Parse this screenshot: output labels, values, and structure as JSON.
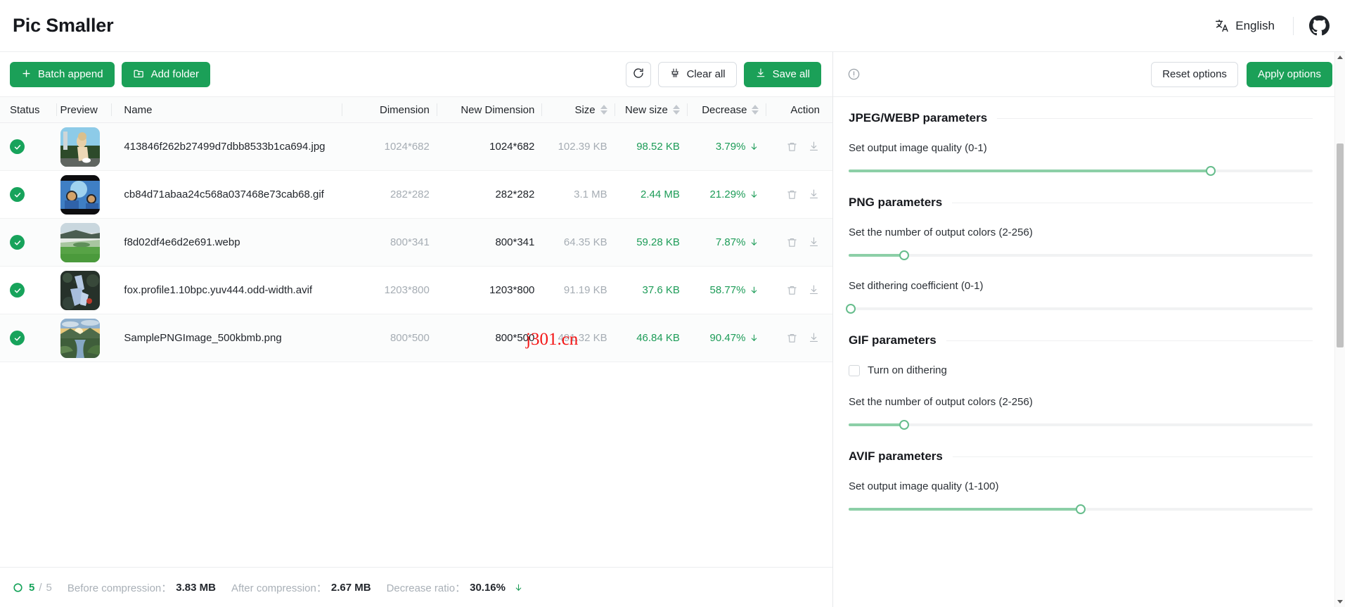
{
  "header": {
    "brand": "Pic Smaller",
    "language_label": "English",
    "language_icon": "translate-icon",
    "github_icon": "github-icon"
  },
  "toolbar": {
    "batch_append_label": "Batch append",
    "add_folder_label": "Add folder",
    "refresh_icon": "refresh-icon",
    "clear_all_label": "Clear all",
    "save_all_label": "Save all"
  },
  "options_toolbar": {
    "info_icon": "info-circle-icon",
    "reset_label": "Reset options",
    "apply_label": "Apply options"
  },
  "table": {
    "columns": [
      {
        "key": "status",
        "label": "Status",
        "sortable": false
      },
      {
        "key": "preview",
        "label": "Preview",
        "sortable": false
      },
      {
        "key": "name",
        "label": "Name",
        "sortable": false
      },
      {
        "key": "dimension",
        "label": "Dimension",
        "sortable": false
      },
      {
        "key": "newdim",
        "label": "New Dimension",
        "sortable": false
      },
      {
        "key": "size",
        "label": "Size",
        "sortable": true
      },
      {
        "key": "newsize",
        "label": "New size",
        "sortable": true
      },
      {
        "key": "decrease",
        "label": "Decrease",
        "sortable": true
      },
      {
        "key": "action",
        "label": "Action",
        "sortable": false
      }
    ],
    "rows": [
      {
        "status": "done",
        "name": "413846f262b27499d7dbb8533b1ca694.jpg",
        "dimension": "1024*682",
        "new_dimension": "1024*682",
        "size": "102.39 KB",
        "new_size": "98.52 KB",
        "decrease": "3.79%"
      },
      {
        "status": "done",
        "name": "cb84d71abaa24c568a037468e73cab68.gif",
        "dimension": "282*282",
        "new_dimension": "282*282",
        "size": "3.1 MB",
        "new_size": "2.44 MB",
        "decrease": "21.29%"
      },
      {
        "status": "done",
        "name": "f8d02df4e6d2e691.webp",
        "dimension": "800*341",
        "new_dimension": "800*341",
        "size": "64.35 KB",
        "new_size": "59.28 KB",
        "decrease": "7.87%"
      },
      {
        "status": "done",
        "name": "fox.profile1.10bpc.yuv444.odd-width.avif",
        "dimension": "1203*800",
        "new_dimension": "1203*800",
        "size": "91.19 KB",
        "new_size": "37.6 KB",
        "decrease": "58.77%"
      },
      {
        "status": "done",
        "name": "SamplePNGImage_500kbmb.png",
        "dimension": "800*500",
        "new_dimension": "800*500",
        "size": "491.32 KB",
        "new_size": "46.84 KB",
        "decrease": "90.47%"
      }
    ],
    "row_actions": {
      "delete_icon": "trash-icon",
      "download_icon": "download-icon"
    }
  },
  "footer": {
    "progress_icon": "circle-icon",
    "done_count": "5",
    "total_sep": "/",
    "total_count": "5",
    "before_label": "Before compression：",
    "before_value": "3.83 MB",
    "after_label": "After compression：",
    "after_value": "2.67 MB",
    "ratio_label": "Decrease ratio：",
    "ratio_value": "30.16%"
  },
  "options": {
    "sections": [
      {
        "title": "JPEG/WEBP parameters",
        "fields": [
          {
            "type": "slider",
            "label": "Set output image quality (0-1)",
            "percent": 78
          }
        ]
      },
      {
        "title": "PNG parameters",
        "fields": [
          {
            "type": "slider",
            "label": "Set the number of output colors (2-256)",
            "percent": 12
          },
          {
            "type": "slider",
            "label": "Set dithering coefficient (0-1)",
            "percent": 0
          }
        ]
      },
      {
        "title": "GIF parameters",
        "fields": [
          {
            "type": "checkbox",
            "label": "Turn on dithering",
            "checked": false
          },
          {
            "type": "slider",
            "label": "Set the number of output colors (2-256)",
            "percent": 12
          }
        ]
      },
      {
        "title": "AVIF parameters",
        "fields": [
          {
            "type": "slider",
            "label": "Set output image quality (1-100)",
            "percent": 50
          }
        ]
      }
    ]
  },
  "watermark": {
    "text": "j301.cn"
  },
  "colors": {
    "brand_green": "#1ba058",
    "status_green": "#17a35b",
    "value_green": "#1d9c58",
    "slider_fill": "#8ccfa7",
    "watermark_red": "#f41515"
  }
}
